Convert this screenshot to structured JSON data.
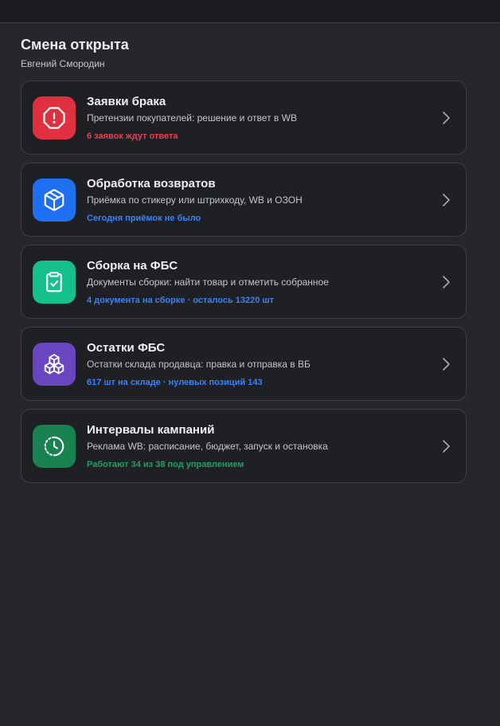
{
  "header": {
    "title": "Смена открыта",
    "user": "Евгений Смородин"
  },
  "cards": [
    {
      "title": "Заявки брака",
      "subtitle": "Претензии покупателей: решение и ответ в WB",
      "status": "6 заявок ждут ответа",
      "icon": "alert-octagon-icon",
      "icon_bg": "#e0303f",
      "status_color": "#e84050"
    },
    {
      "title": "Обработка возвратов",
      "subtitle": "Приёмка по стикеру или штрихкоду, WB и ОЗОН",
      "status": "Сегодня приёмок не было",
      "icon": "box-icon",
      "icon_bg": "#1f6ff2",
      "status_color": "#3b82f6"
    },
    {
      "title": "Сборка на ФБС",
      "subtitle": "Документы сборки: найти товар и отметить собранное",
      "status": "4 документа на сборке · осталось 13220 шт",
      "icon": "clipboard-check-icon",
      "icon_bg": "#16c08b",
      "status_color": "#3b82f6"
    },
    {
      "title": "Остатки ФБС",
      "subtitle": "Остатки склада продавца: правка и отправка в ВБ",
      "status": "617 шт на складе · нулевых позиций 143",
      "icon": "boxes-stack-icon",
      "icon_bg": "#6a45c2",
      "status_color": "#3b82f6"
    },
    {
      "title": "Интервалы кампаний",
      "subtitle": "Реклама WB: расписание, бюджет, запуск и остановка",
      "status": "Работают 34 из 38 под управлением",
      "icon": "clock-dashed-icon",
      "icon_bg": "#188250",
      "status_color": "#1fa063"
    }
  ]
}
